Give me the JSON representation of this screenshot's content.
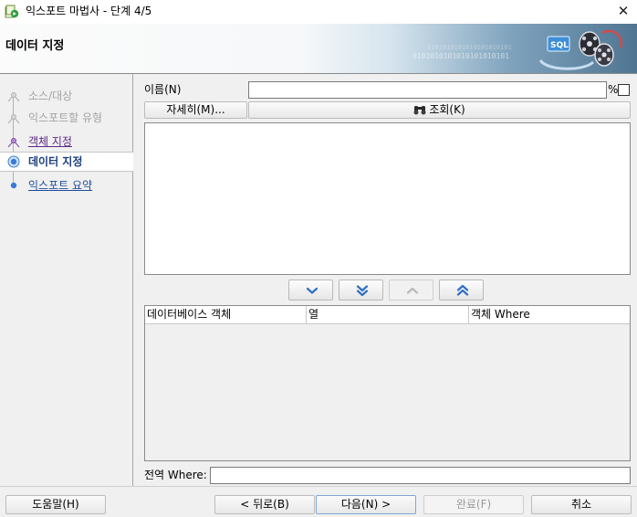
{
  "window": {
    "title": "익스포트 마법사 - 단계 4/5",
    "app_icon": "wizard-app-icon",
    "close_icon": "close-x-icon",
    "close_glyph": "✕"
  },
  "banner": {
    "title": "데이터 지정",
    "art": "sql-database-export-art",
    "binary_text": "0101010101010101010101",
    "sql_badge": "SQL"
  },
  "steps": [
    {
      "label": "소스/대상",
      "state": "disabled"
    },
    {
      "label": "익스포트할 유형",
      "state": "disabled"
    },
    {
      "label": "객체 지정",
      "state": "visited"
    },
    {
      "label": "데이터 지정",
      "state": "current"
    },
    {
      "label": "익스포트 요약",
      "state": "link"
    }
  ],
  "name_filter": {
    "label": "이름(N)",
    "value": "",
    "percent_suffix": "%",
    "percent_checked": false
  },
  "buttons": {
    "details": "자세히(M)...",
    "query": "조회(K)",
    "query_icon": "binoculars-icon",
    "help": "도움말(H)",
    "back": "< 뒤로(B)",
    "next": "다음(N) >",
    "finish": "완료(F)",
    "cancel": "취소"
  },
  "available_objects": [],
  "move_buttons": [
    {
      "name": "move-down-button",
      "icon": "chevron-down-icon",
      "enabled": true
    },
    {
      "name": "move-all-down-button",
      "icon": "double-chevron-down-icon",
      "enabled": true
    },
    {
      "name": "move-up-button",
      "icon": "chevron-up-icon",
      "enabled": false
    },
    {
      "name": "move-all-up-button",
      "icon": "double-chevron-up-icon",
      "enabled": true
    }
  ],
  "table": {
    "columns": [
      "데이터베이스 객체",
      "열",
      "객체 Where"
    ],
    "rows": []
  },
  "global_where": {
    "label": "전역 Where:",
    "value": ""
  },
  "colors": {
    "visited_link": "#5b2a86",
    "link": "#1d4d9b",
    "current_step": "#1d3f7e",
    "node_blue": "#3a7bd5",
    "disabled_text": "#a4a4a4",
    "banner_blue": "#4f7592"
  }
}
